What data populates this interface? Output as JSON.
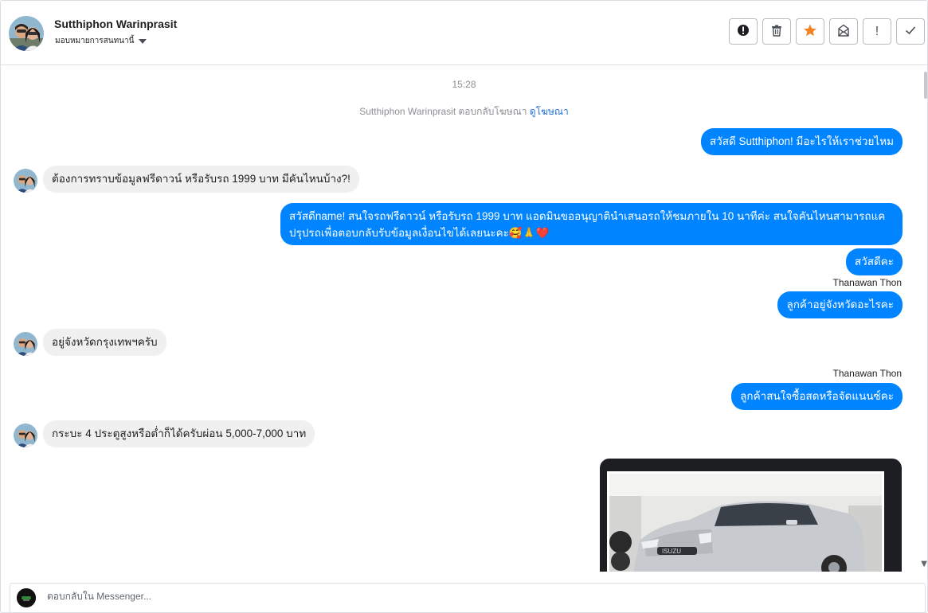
{
  "header": {
    "contact_name": "Sutthiphon Warinprasit",
    "assign_label": "มอบหมายการสนทนานี้",
    "toolbar": [
      {
        "name": "report-icon",
        "glyph": "❗"
      },
      {
        "name": "trash-icon",
        "glyph": "🗑"
      },
      {
        "name": "star-icon",
        "glyph": "★"
      },
      {
        "name": "archive-icon",
        "glyph": "✉"
      },
      {
        "name": "exclamation-icon",
        "glyph": "!"
      },
      {
        "name": "check-icon",
        "glyph": "✓"
      }
    ]
  },
  "chat": {
    "timestamp": "15:28",
    "ad_reply_prefix": "Sutthiphon Warinprasit ตอบกลับโฆษณา",
    "ad_link": "ดูโฆษณา",
    "messages": [
      {
        "text": "สวัสดี Sutthiphon! มีอะไรให้เราช่วยไหม"
      },
      {
        "text": "ต้องการทราบข้อมูลฟรีดาวน์ หรือรับรถ 1999 บาท มีคันไหนบ้าง?!"
      },
      {
        "text": "สวัสดีname! สนใจรถฟรีดาวน์ หรือรับรถ 1999 บาท แอดมินขออนุญาตินำเสนอรถให้ชมภายใน 10 นาทีค่ะ สนใจคันไหนสามารถแค ปรุปรถเพื่อตอบกลับรับข้อมูลเงื่อนไขได้เลยนะคะ🥰🙏❤️"
      },
      {
        "text": "สวัสดีคะ"
      },
      {
        "text": "Thanawan Thon"
      },
      {
        "text": "ลูกค้าอยู่จังหวัดอะไรคะ"
      },
      {
        "text": "อยู่จังหวัดกรุงเทพฯครับ"
      },
      {
        "text": "Thanawan Thon"
      },
      {
        "text": "ลูกค้าสนใจซื้อสดหรือจัดแนนซ์คะ"
      },
      {
        "text": "กระบะ 4 ประตูสูงหรือต่ำก็ได้ครับผ่อน 5,000-7,000 บาท"
      }
    ]
  },
  "composer": {
    "placeholder": "ตอบกลับใน Messenger..."
  },
  "colors": {
    "outgoing_bubble": "#0084ff",
    "incoming_bubble": "#f1f0f0",
    "star_accent": "#f58220",
    "link": "#216fdb"
  }
}
